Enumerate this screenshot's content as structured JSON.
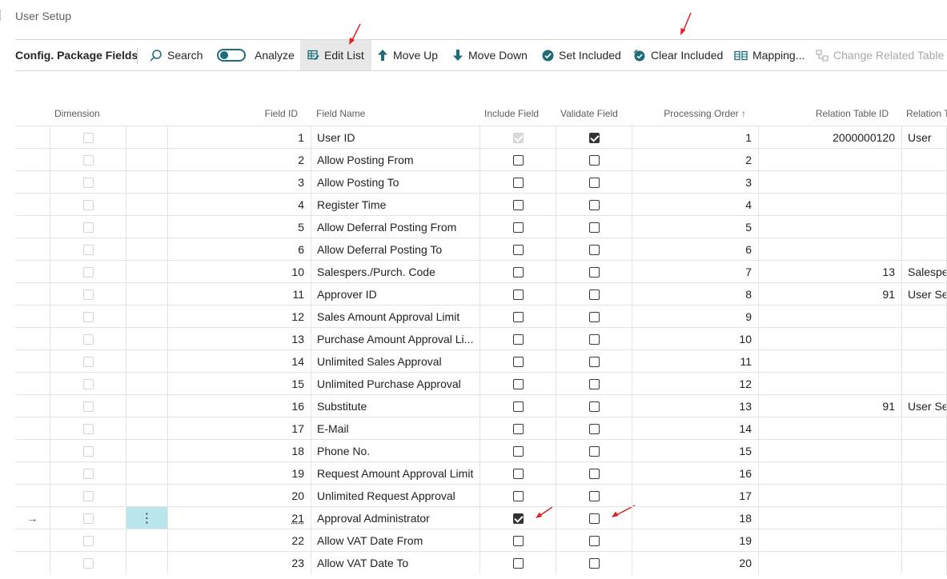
{
  "page": {
    "title": "User Setup"
  },
  "toolbar": {
    "caption": "Config. Package Fields",
    "search": "Search",
    "analyze": "Analyze",
    "edit_list": "Edit List",
    "move_up": "Move Up",
    "move_down": "Move Down",
    "set_included": "Set Included",
    "clear_included": "Clear Included",
    "mapping": "Mapping...",
    "change_related_table": "Change Related Table"
  },
  "columns": {
    "dimension": "Dimension",
    "field_id": "Field ID",
    "field_name": "Field Name",
    "include_field": "Include Field",
    "validate_field": "Validate Field",
    "processing_order": "Processing Order ↑",
    "relation_table_id": "Relation Table ID",
    "relation_table": "Relation T"
  },
  "selected_row_marker": "→",
  "row_menu": "⋮",
  "rows": [
    {
      "field_id": "1",
      "field_name": "User ID",
      "include": true,
      "include_disabled": true,
      "validate": true,
      "order": "1",
      "rel_id": "2000000120",
      "rel_name": "User"
    },
    {
      "field_id": "2",
      "field_name": "Allow Posting From",
      "include": false,
      "validate": false,
      "order": "2",
      "rel_id": "",
      "rel_name": ""
    },
    {
      "field_id": "3",
      "field_name": "Allow Posting To",
      "include": false,
      "validate": false,
      "order": "3",
      "rel_id": "",
      "rel_name": ""
    },
    {
      "field_id": "4",
      "field_name": "Register Time",
      "include": false,
      "validate": false,
      "order": "4",
      "rel_id": "",
      "rel_name": ""
    },
    {
      "field_id": "5",
      "field_name": "Allow Deferral Posting From",
      "include": false,
      "validate": false,
      "order": "5",
      "rel_id": "",
      "rel_name": ""
    },
    {
      "field_id": "6",
      "field_name": "Allow Deferral Posting To",
      "include": false,
      "validate": false,
      "order": "6",
      "rel_id": "",
      "rel_name": ""
    },
    {
      "field_id": "10",
      "field_name": "Salespers./Purch. Code",
      "include": false,
      "validate": false,
      "order": "7",
      "rel_id": "13",
      "rel_name": "Salesper"
    },
    {
      "field_id": "11",
      "field_name": "Approver ID",
      "include": false,
      "validate": false,
      "order": "8",
      "rel_id": "91",
      "rel_name": "User Set"
    },
    {
      "field_id": "12",
      "field_name": "Sales Amount Approval Limit",
      "include": false,
      "validate": false,
      "order": "9",
      "rel_id": "",
      "rel_name": ""
    },
    {
      "field_id": "13",
      "field_name": "Purchase Amount Approval Li...",
      "include": false,
      "validate": false,
      "order": "10",
      "rel_id": "",
      "rel_name": ""
    },
    {
      "field_id": "14",
      "field_name": "Unlimited Sales Approval",
      "include": false,
      "validate": false,
      "order": "11",
      "rel_id": "",
      "rel_name": ""
    },
    {
      "field_id": "15",
      "field_name": "Unlimited Purchase Approval",
      "include": false,
      "validate": false,
      "order": "12",
      "rel_id": "",
      "rel_name": ""
    },
    {
      "field_id": "16",
      "field_name": "Substitute",
      "include": false,
      "validate": false,
      "order": "13",
      "rel_id": "91",
      "rel_name": "User Set"
    },
    {
      "field_id": "17",
      "field_name": "E-Mail",
      "include": false,
      "validate": false,
      "order": "14",
      "rel_id": "",
      "rel_name": ""
    },
    {
      "field_id": "18",
      "field_name": "Phone No.",
      "include": false,
      "validate": false,
      "order": "15",
      "rel_id": "",
      "rel_name": ""
    },
    {
      "field_id": "19",
      "field_name": "Request Amount Approval Limit",
      "include": false,
      "validate": false,
      "order": "16",
      "rel_id": "",
      "rel_name": ""
    },
    {
      "field_id": "20",
      "field_name": "Unlimited Request Approval",
      "include": false,
      "validate": false,
      "order": "17",
      "rel_id": "",
      "rel_name": ""
    },
    {
      "field_id": "21",
      "field_name": "Approval Administrator",
      "include": true,
      "validate": false,
      "order": "18",
      "rel_id": "",
      "rel_name": "",
      "selected": true
    },
    {
      "field_id": "22",
      "field_name": "Allow VAT Date From",
      "include": false,
      "validate": false,
      "order": "19",
      "rel_id": "",
      "rel_name": ""
    },
    {
      "field_id": "23",
      "field_name": "Allow VAT Date To",
      "include": false,
      "validate": false,
      "order": "20",
      "rel_id": "",
      "rel_name": ""
    }
  ],
  "colors": {
    "accent": "#1d6c77",
    "selection": "#b9e6ec",
    "annotation": "#e02020"
  }
}
